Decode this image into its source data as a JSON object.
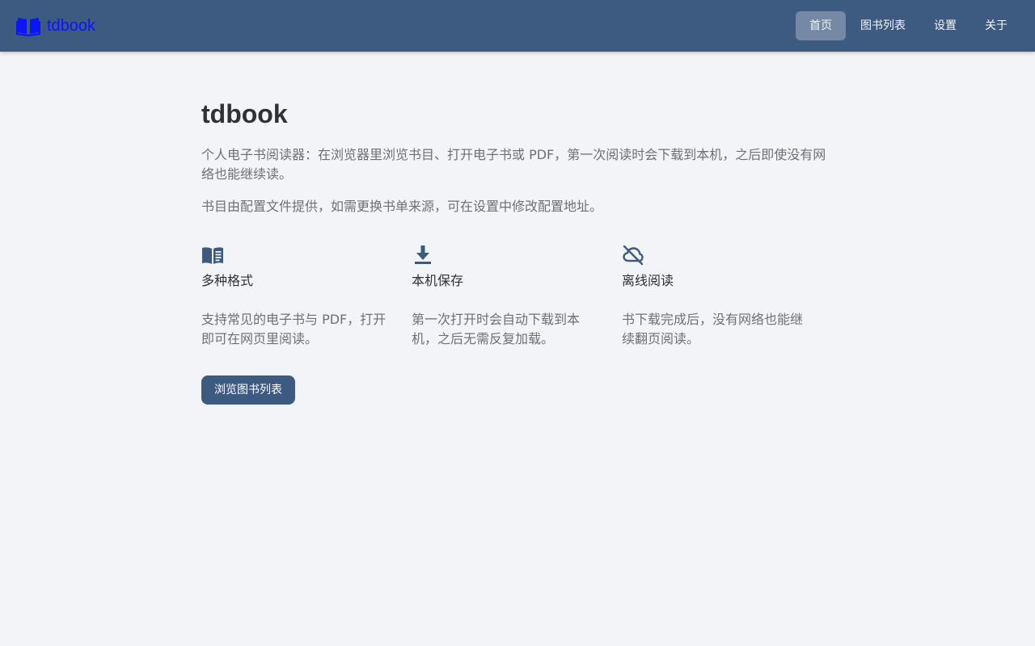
{
  "navbar": {
    "brand": "tdbook",
    "brand_icon": "book-open-icon",
    "items": [
      {
        "label": "首页",
        "active": true
      },
      {
        "label": "图书列表",
        "active": false
      },
      {
        "label": "设置",
        "active": false
      },
      {
        "label": "关于",
        "active": false
      }
    ]
  },
  "main": {
    "title": "tdbook",
    "desc1": "个人电子书阅读器：在浏览器里浏览书目、打开电子书或 PDF，第一次阅读时会下载到本机，之后即使没有网络也能继续读。",
    "desc2": "书目由配置文件提供，如需更换书单来源，可在设置中修改配置地址。",
    "features": [
      {
        "icon": "open-book-icon",
        "title": "多种格式",
        "desc": "支持常见的电子书与 PDF，打开即可在网页里阅读。"
      },
      {
        "icon": "download-icon",
        "title": "本机保存",
        "desc": "第一次打开时会自动下载到本机，之后无需反复加载。"
      },
      {
        "icon": "cloud-off-icon",
        "title": "离线阅读",
        "desc": "书下载完成后，没有网络也能继续翻页阅读。"
      }
    ],
    "cta_label": "浏览图书列表"
  },
  "colors": {
    "navbar_bg": "#3d5a80",
    "nav_active_bg": "#7689a4",
    "brand_text": "#0a14ff",
    "page_bg": "#f3f4f7",
    "accent": "#3d5a80"
  }
}
